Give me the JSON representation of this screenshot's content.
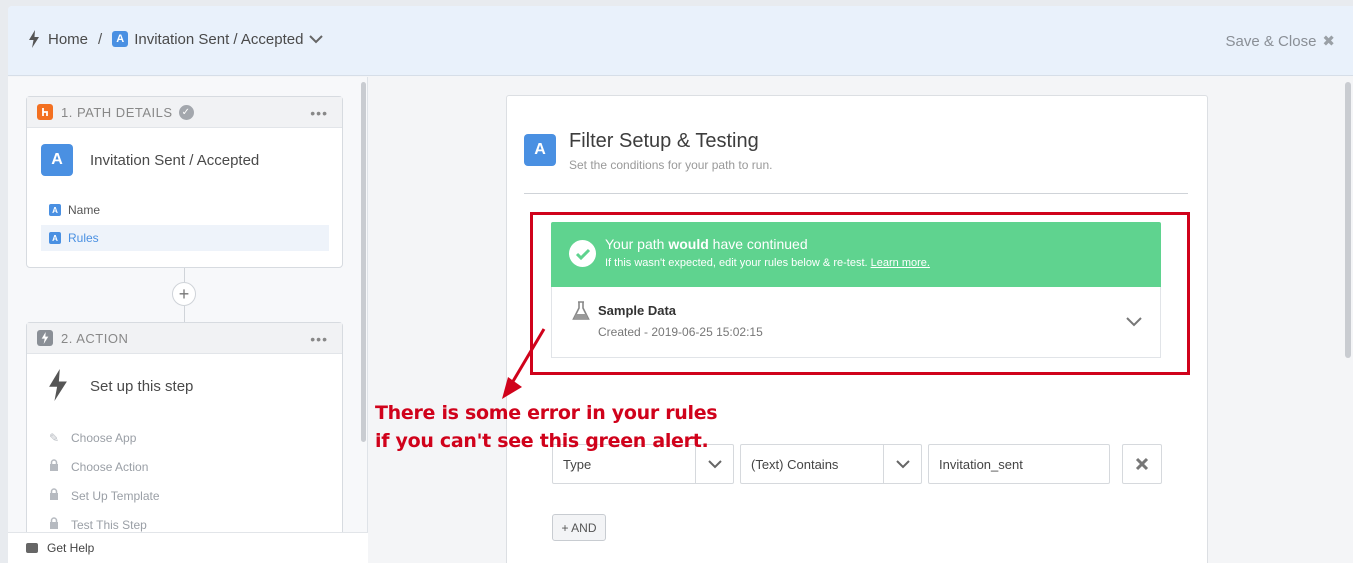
{
  "header": {
    "home_label": "Home",
    "separator": "/",
    "path_badge": "A",
    "path_title": "Invitation Sent / Accepted",
    "save_close_label": "Save & Close",
    "close_glyph": "✖"
  },
  "sidebar": {
    "step1": {
      "title": "1. PATH DETAILS",
      "menu": "•••",
      "badge": "A",
      "name": "Invitation Sent / Accepted",
      "items": [
        {
          "badge": "A",
          "label": "Name",
          "active": false
        },
        {
          "badge": "A",
          "label": "Rules",
          "active": true
        }
      ]
    },
    "add_button": "+",
    "step2": {
      "title": "2. ACTION",
      "menu": "•••",
      "name": "Set up this step",
      "items": [
        {
          "icon": "pencil-icon",
          "label": "Choose App"
        },
        {
          "icon": "lock-icon",
          "label": "Choose Action"
        },
        {
          "icon": "lock-icon",
          "label": "Set Up Template"
        },
        {
          "icon": "lock-icon",
          "label": "Test This Step"
        }
      ]
    },
    "help_label": "Get Help"
  },
  "main": {
    "badge": "A",
    "title": "Filter Setup & Testing",
    "subtitle": "Set the conditions for your path to run.",
    "alert": {
      "text_before": "Your path ",
      "text_bold": "would",
      "text_after": " have continued",
      "sub_before": "If this wasn't expected, edit your rules below & re-test. ",
      "sub_link": "Learn more.",
      "color": "#5fd38f"
    },
    "sample": {
      "title": "Sample Data",
      "created": "Created - 2019-06-25 15:02:15"
    },
    "rule": {
      "field": "Type",
      "operator": "(Text) Contains",
      "value": "Invitation_sent"
    },
    "and_button": "+ AND"
  },
  "annotation": {
    "line1": "There is some error in your rules",
    "line2": "if you can't see this green alert.",
    "color": "#d0021b"
  }
}
